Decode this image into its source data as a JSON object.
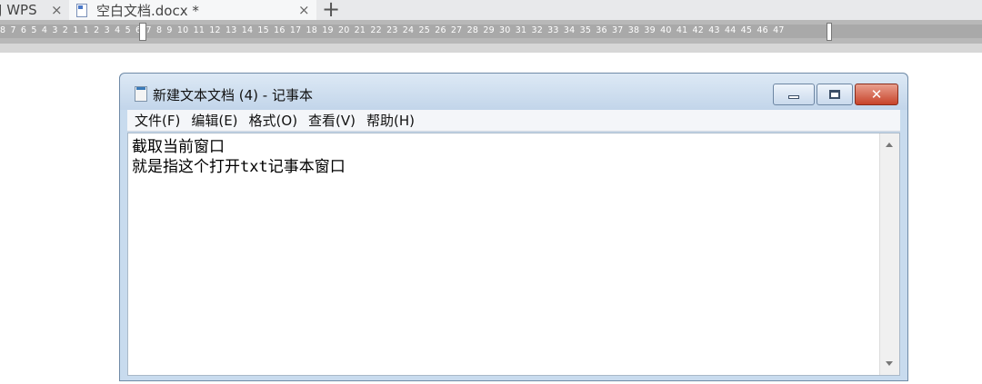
{
  "wps": {
    "tabs": [
      {
        "label": "J WPS",
        "close": "×"
      },
      {
        "label": "空白文档.docx *",
        "close": "×"
      }
    ],
    "new_tab": "+",
    "ruler_text": "8  7  6  5  4  3  2  1        1  2  3  4  5  6  7  8  9  10 11 12 13 14 15 16 17 18 19 20 21 22 23 24 25 26 27 28 29 30 31 32 33 34 35 36 37 38 39  40 41 42 43 44 45 46 47"
  },
  "notepad": {
    "title": "新建文本文档 (4) - 记事本",
    "close_glyph": "✕",
    "menu": [
      "文件(F)",
      "编辑(E)",
      "格式(O)",
      "查看(V)",
      "帮助(H)"
    ],
    "content": "截取当前窗口\n就是指这个打开txt记事本窗口"
  }
}
